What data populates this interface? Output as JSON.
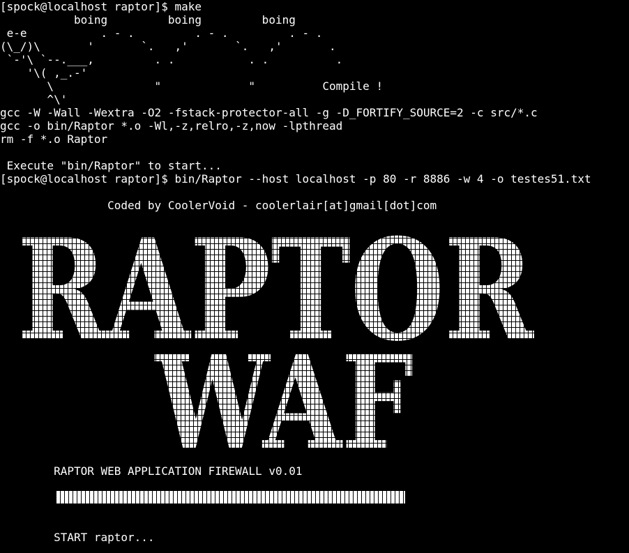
{
  "terminal": {
    "lines": [
      "[spock@localhost raptor]$ make",
      "           boing         boing         boing",
      " e-e           . - .         . - .         . - .",
      "(\\_/)\\       '       `.   ,'       `.   ,'       .",
      " `-'\\ `--.___,         . .           . .          .",
      "    '\\( ,_.-'",
      "       \\               \"             \"          Compile !",
      "       ^\\'",
      "gcc -W -Wall -Wextra -O2 -fstack-protector-all -g -D_FORTIFY_SOURCE=2 -c src/*.c",
      "gcc -o bin/Raptor *.o -Wl,-z,relro,-z,now -lpthread",
      "rm -f *.o Raptor",
      "",
      " Execute \"bin/Raptor\" to start...",
      "[spock@localhost raptor]$ bin/Raptor --host localhost -p 80 -r 8886 -w 4 -o testes51.txt",
      "",
      "                Coded by CoolerVoid - coolerlair[at]gmail[dot]com"
    ],
    "banner_line1": "RAPTOR",
    "banner_line2": "WAF",
    "footer": {
      "title": "        RAPTOR WEB APPLICATION FIREWALL v0.01",
      "progress": 1.0,
      "status": "        START raptor..."
    },
    "colors": {
      "background": "#000000",
      "foreground": "#ffffff"
    }
  }
}
